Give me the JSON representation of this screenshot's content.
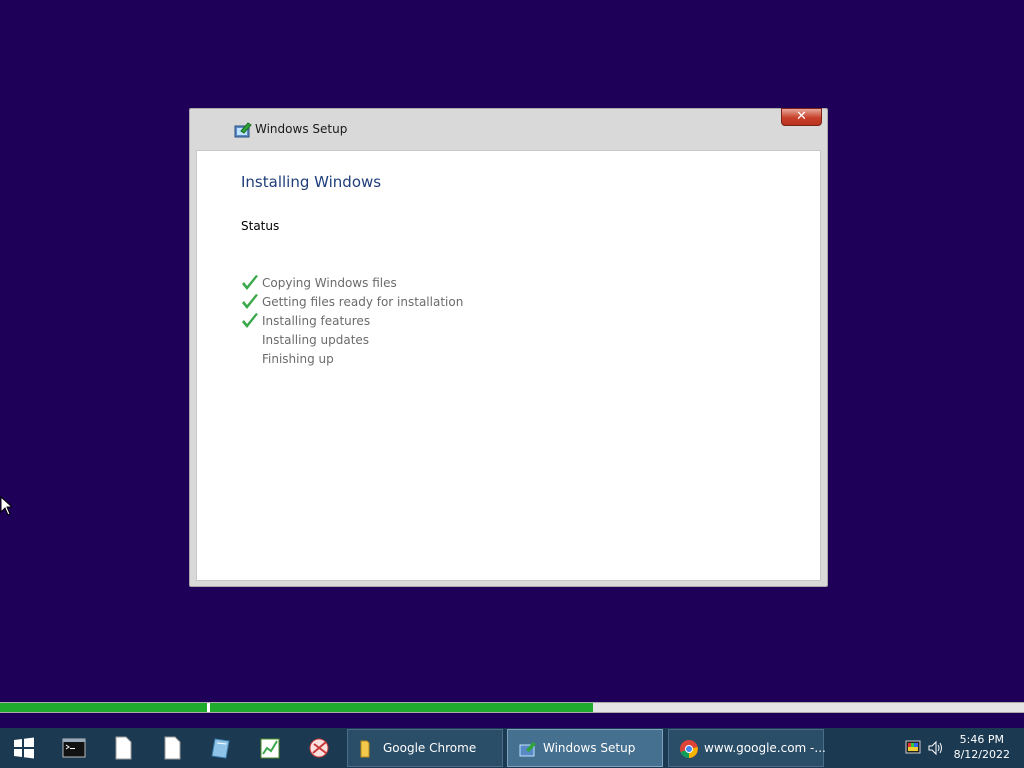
{
  "window": {
    "title": "Windows Setup",
    "close_glyph": "✕",
    "heading": "Installing Windows",
    "status_label": "Status",
    "steps": [
      {
        "label": "Copying Windows files",
        "done": true
      },
      {
        "label": "Getting files ready for installation",
        "done": true
      },
      {
        "label": "Installing features",
        "done": true
      },
      {
        "label": "Installing updates",
        "done": false
      },
      {
        "label": "Finishing up",
        "done": false
      }
    ]
  },
  "progress": {
    "stage1_complete": 1.0,
    "stage2_fraction": 0.47
  },
  "taskbar": {
    "pinned": [
      "start-icon",
      "command-prompt-icon",
      "document-icon",
      "document-icon",
      "glass-icon",
      "chart-icon",
      "scissors-icon"
    ],
    "tasks": [
      {
        "label": "Google Chrome",
        "icon": "folder-icon",
        "active": false
      },
      {
        "label": "Windows Setup",
        "icon": "setup-icon",
        "active": true
      },
      {
        "label": "www.google.com -...",
        "icon": "chrome-icon",
        "active": false
      }
    ],
    "tray": {
      "time": "5:46 PM",
      "date": "8/12/2022"
    }
  },
  "colors": {
    "desktop": "#1f0058",
    "progress_fill": "#1fab2e",
    "heading": "#1f3e7a"
  }
}
